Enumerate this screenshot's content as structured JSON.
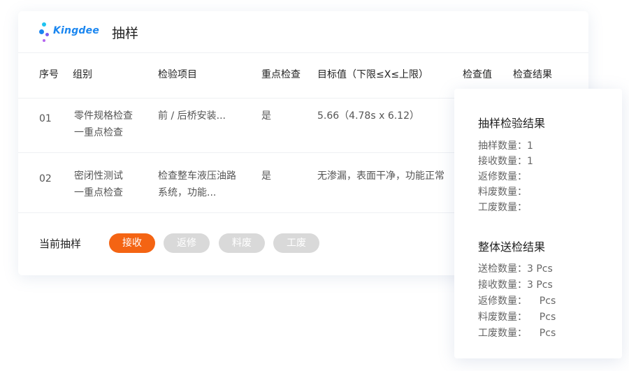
{
  "header": {
    "brand": "Kingdee",
    "title": "抽样"
  },
  "table": {
    "columns": [
      "序号",
      "组别",
      "检验项目",
      "重点检查",
      "目标值（下限≤X≤上限）",
      "检查值",
      "检查结果"
    ],
    "rows": [
      {
        "no": "01",
        "group": [
          "零件规格检查",
          "一重点检查"
        ],
        "item": [
          "前 / 后桥安装..."
        ],
        "key": "是",
        "target": "5.66（4.78s x 6.12）"
      },
      {
        "no": "02",
        "group": [
          "密闭性测试",
          "一重点检查"
        ],
        "item": [
          "检查整车液压油路",
          "系统，功能..."
        ],
        "key": "是",
        "target": "无渗漏，表面干净，功能正常"
      }
    ]
  },
  "footer": {
    "label": "当前抽样",
    "buttons": [
      {
        "label": "接收",
        "active": true
      },
      {
        "label": "返修",
        "active": false
      },
      {
        "label": "料废",
        "active": false
      },
      {
        "label": "工废",
        "active": false
      }
    ]
  },
  "sample_result": {
    "title": "抽样检验结果",
    "lines": [
      "抽样数量：1",
      "接收数量：1",
      "返修数量：",
      "料废数量：",
      "工废数量："
    ]
  },
  "overall_result": {
    "title": "整体送检结果",
    "lines": [
      "送检数量：3 Pcs",
      "接收数量：3 Pcs",
      "返修数量：    Pcs",
      "料废数量：    Pcs",
      "工废数量：    Pcs"
    ]
  },
  "colors": {
    "accent": "#f46413",
    "brand": "#1a86f0",
    "inactive": "#d9d9d9"
  }
}
